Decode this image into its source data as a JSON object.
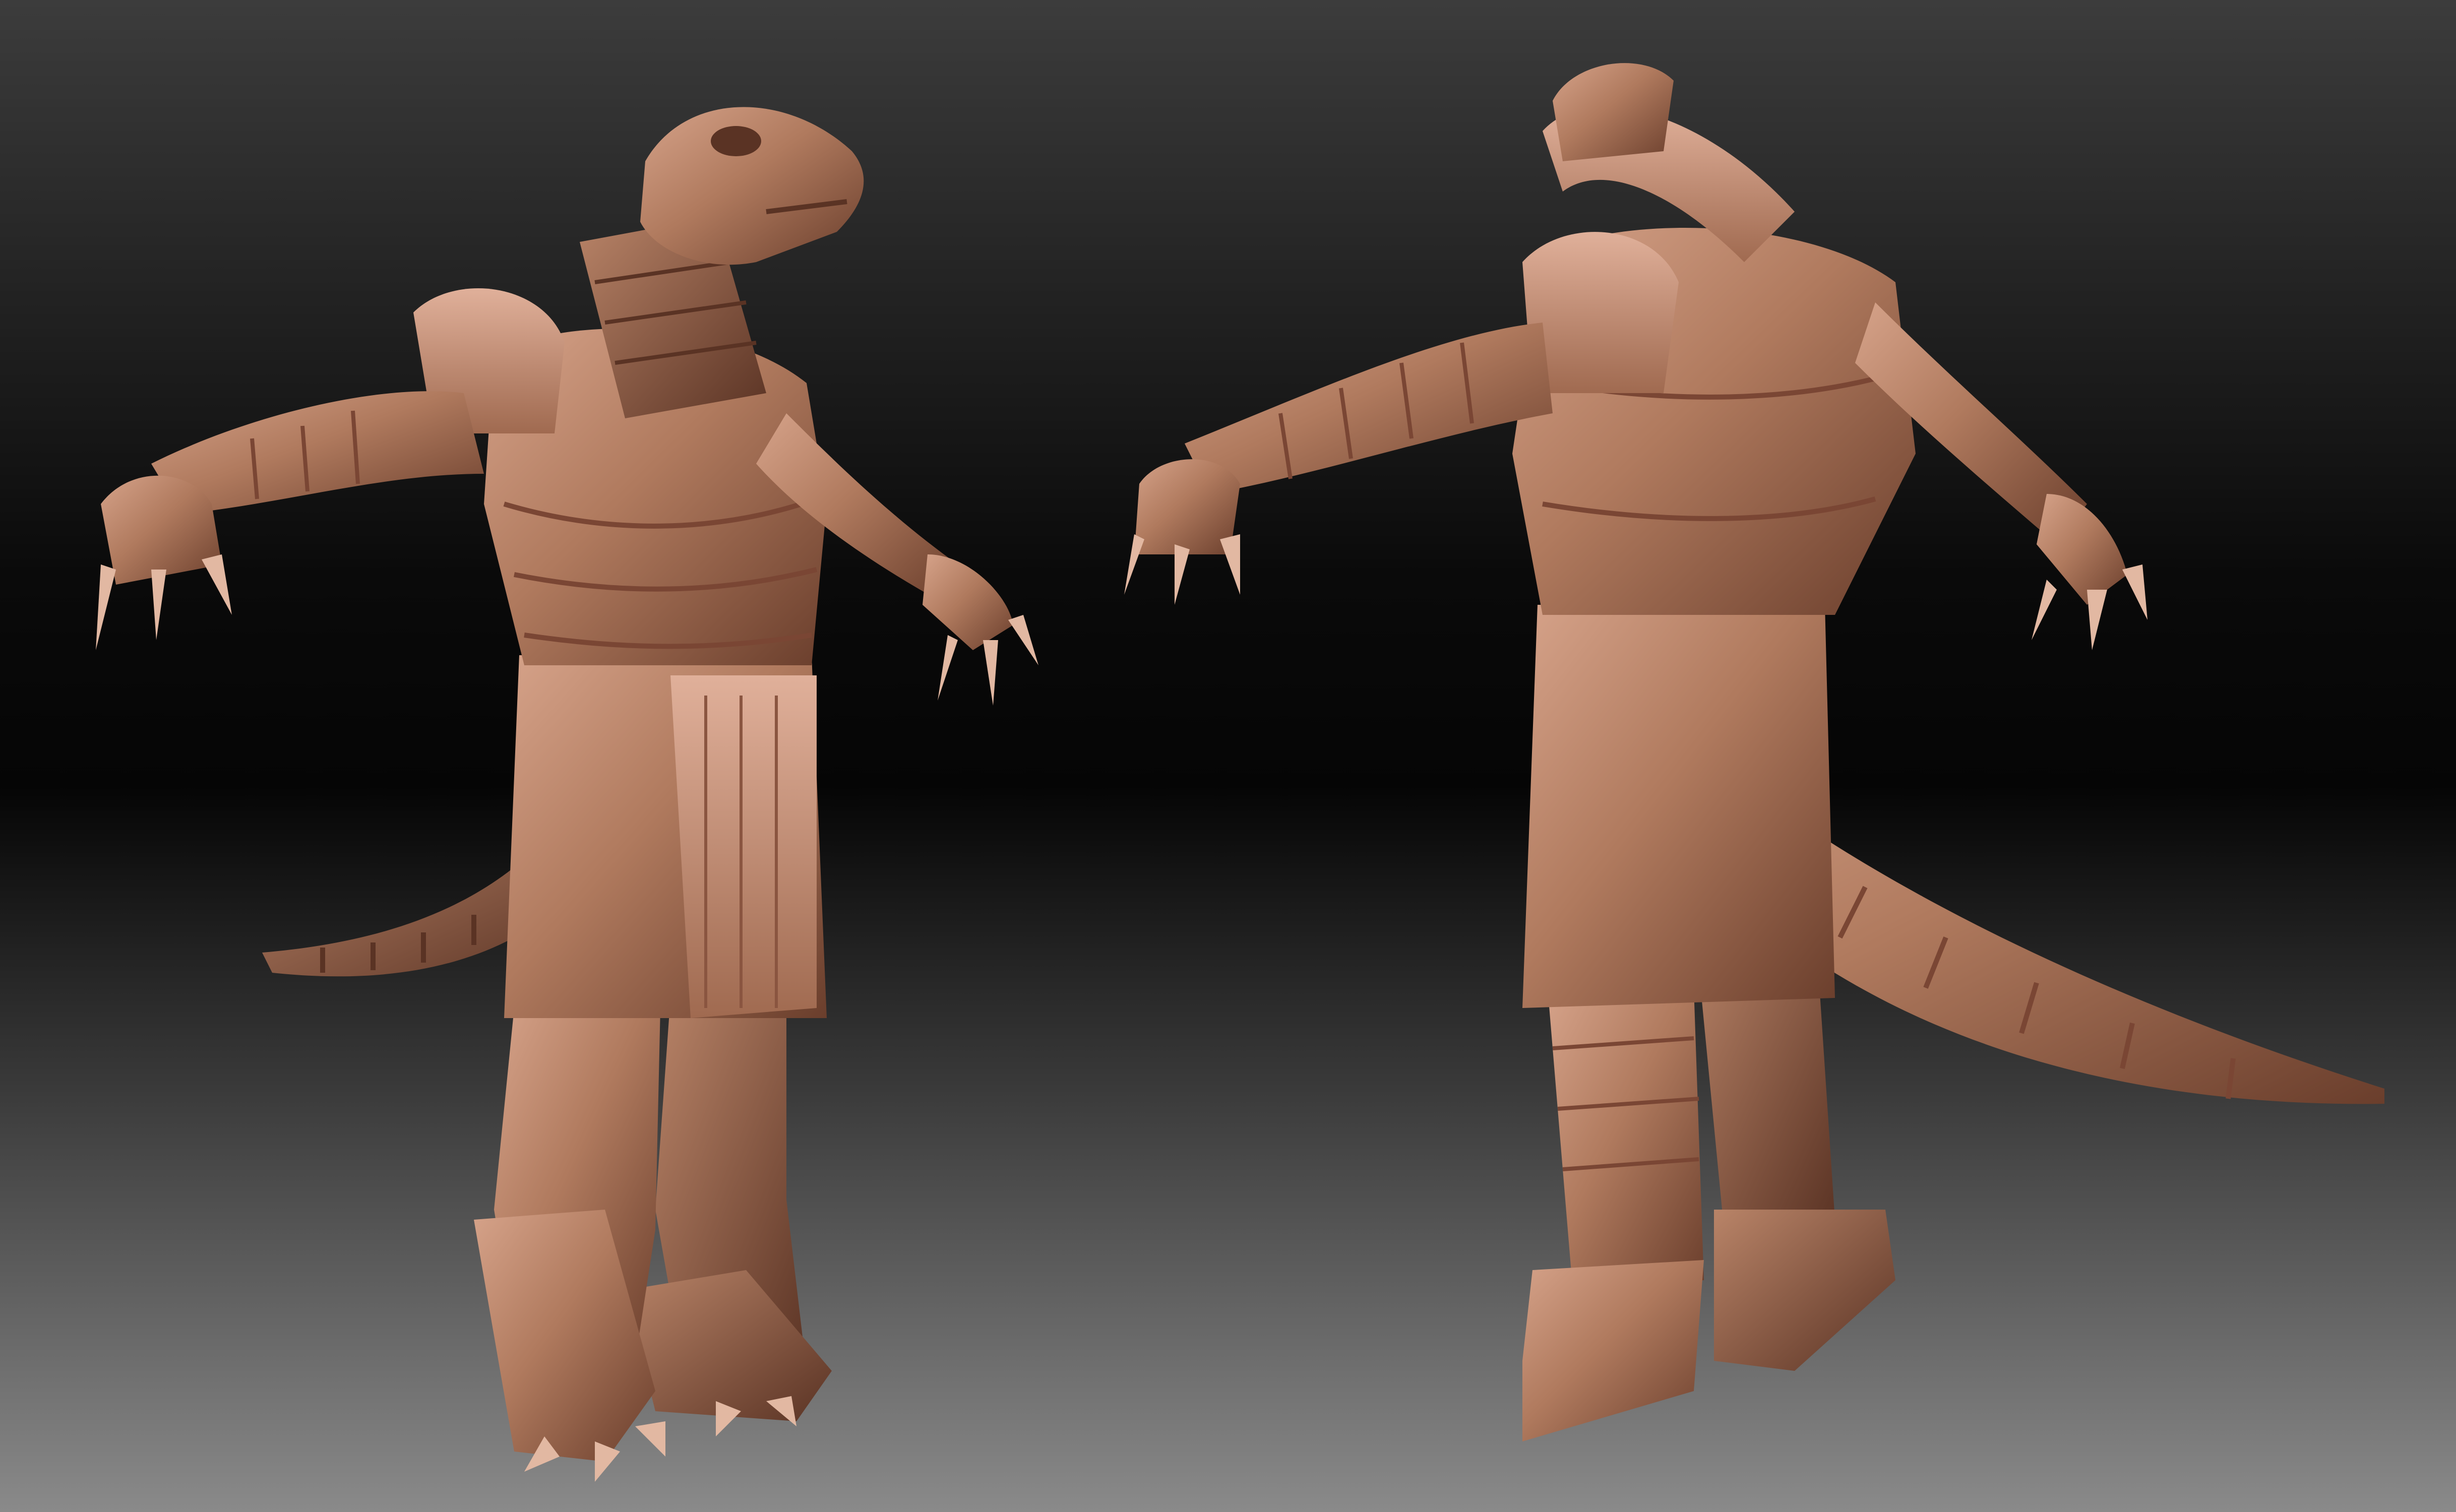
{
  "scene": {
    "background_top": "#3c3c3c",
    "background_mid": "#050505",
    "background_bottom": "#8a8a8a",
    "clay_color": "#b07a5e",
    "clay_highlight": "#d4a088",
    "clay_shadow": "#6a3e2c",
    "models": [
      {
        "view": "front-three-quarter"
      },
      {
        "view": "back-three-quarter"
      }
    ]
  }
}
